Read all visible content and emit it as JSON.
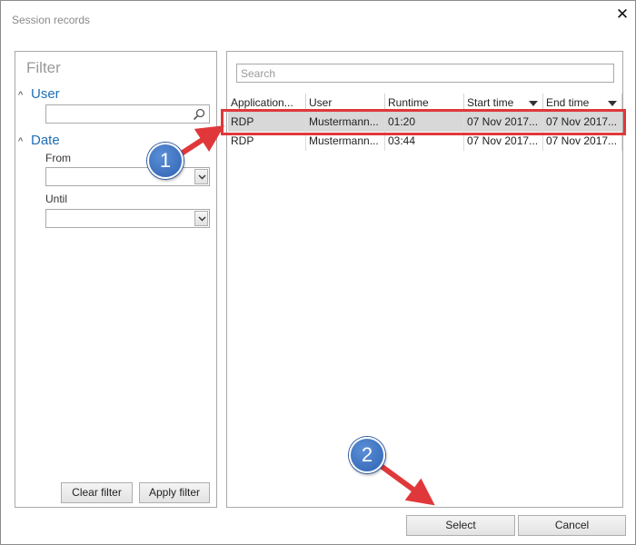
{
  "window": {
    "title": "Session records",
    "close_glyph": "✕"
  },
  "filter": {
    "heading": "Filter",
    "user": {
      "label": "User",
      "value": ""
    },
    "date": {
      "label": "Date",
      "from_label": "From",
      "from_value": "",
      "until_label": "Until",
      "until_value": ""
    },
    "clear_label": "Clear filter",
    "apply_label": "Apply filter"
  },
  "list": {
    "search_placeholder": "Search",
    "columns": [
      "Application...",
      "User",
      "Runtime",
      "Start time",
      "End time"
    ],
    "rows": [
      {
        "application": "RDP",
        "user": "Mustermann...",
        "runtime": "01:20",
        "start": "07 Nov 2017...",
        "end": "07 Nov 2017...",
        "selected": true
      },
      {
        "application": "RDP",
        "user": "Mustermann...",
        "runtime": "03:44",
        "start": "07 Nov 2017...",
        "end": "07 Nov 2017...",
        "selected": false
      }
    ]
  },
  "footer": {
    "select_label": "Select",
    "cancel_label": "Cancel"
  },
  "annotations": {
    "step1": "1",
    "step2": "2",
    "highlight_color": "#e0383a",
    "badge_color": "#2f63b3"
  },
  "icons": {
    "close": "close-icon",
    "search": "magnifier-icon",
    "dropdown": "chevron-down-icon",
    "collapse": "chevron-up-icon",
    "sort": "sort-down-icon"
  }
}
